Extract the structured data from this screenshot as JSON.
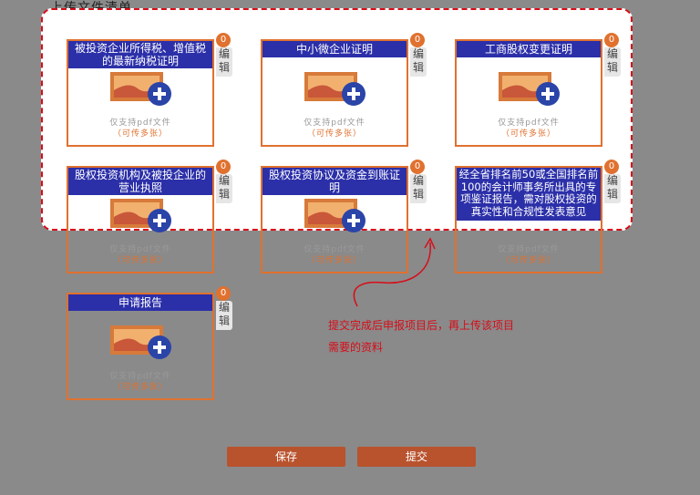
{
  "section": {
    "title": "上传文件清单"
  },
  "cards": [
    {
      "title": "被投资企业所得税、增值税的最新纳税证明",
      "count": "0",
      "edit": "编辑",
      "hint": "仅支持pdf文件",
      "multi": "（可传多张）"
    },
    {
      "title": "中小微企业证明",
      "count": "0",
      "edit": "编辑",
      "hint": "仅支持pdf文件",
      "multi": "（可传多张）"
    },
    {
      "title": "工商股权变更证明",
      "count": "0",
      "edit": "编辑",
      "hint": "仅支持pdf文件",
      "multi": "（可传多张）"
    },
    {
      "title": "股权投资机构及被投企业的营业执照",
      "count": "0",
      "edit": "编辑",
      "hint": "仅支持pdf文件",
      "multi": "（可传多张）"
    },
    {
      "title": "股权投资协议及资金到账证明",
      "count": "0",
      "edit": "编辑",
      "hint": "仅支持pdf文件",
      "multi": "（可传多张）"
    },
    {
      "title": "经全省排名前50或全国排名前100的会计师事务所出具的专项鉴证报告，需对股权投资的真实性和合规性发表意见",
      "count": "0",
      "edit": "编辑",
      "hint": "仅支持pdf文件",
      "multi": "（可传多张）"
    },
    {
      "title": "申请报告",
      "count": "0",
      "edit": "编辑",
      "hint": "仅支持pdf文件",
      "multi": "（可传多张）"
    }
  ],
  "annotation": {
    "line1": "提交完成后申报项目后，再上传该项目",
    "line2": "需要的资料"
  },
  "buttons": {
    "save": "保存",
    "submit": "提交"
  },
  "colors": {
    "accent": "#e0712f",
    "title_bg": "#2b2fa8",
    "dash": "#d80c18",
    "button": "#b8532e"
  }
}
